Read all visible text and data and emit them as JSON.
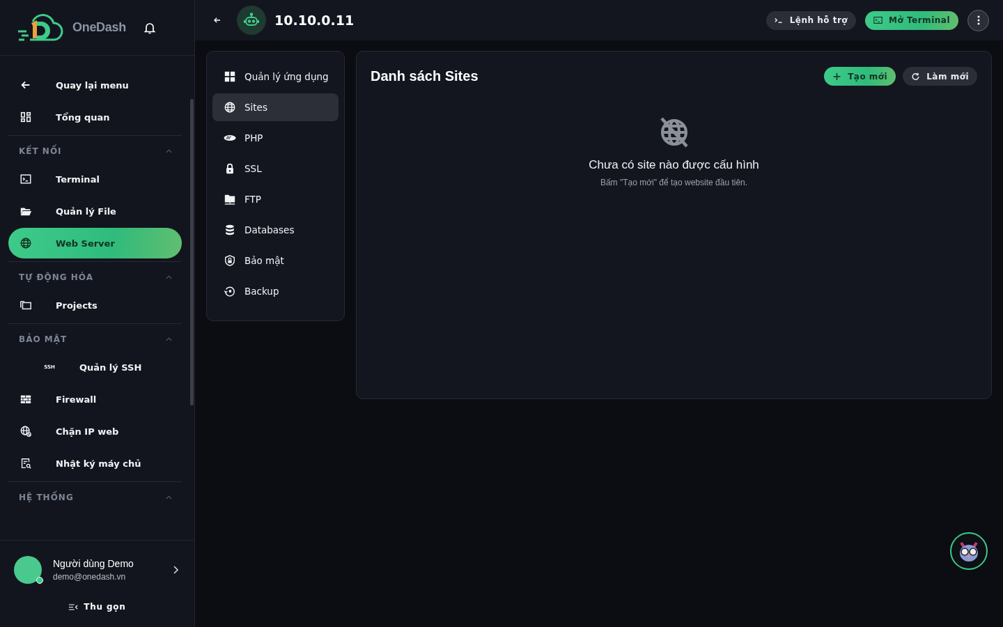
{
  "brand": {
    "name": "OneDash"
  },
  "sidebar": {
    "top_items": [
      {
        "label": "Quay lại menu",
        "kind": "back",
        "selected": false
      },
      {
        "label": "Tổng quan",
        "kind": "dashboard",
        "selected": false
      }
    ],
    "sections": [
      {
        "heading": "KẾT NỐI",
        "expanded": true,
        "items": [
          {
            "label": "Terminal",
            "kind": "terminal",
            "selected": false
          },
          {
            "label": "Quản lý File",
            "kind": "folder",
            "selected": false
          },
          {
            "label": "Web Server",
            "kind": "globe",
            "selected": true
          }
        ]
      },
      {
        "heading": "TỰ ĐỘNG HÓA",
        "expanded": true,
        "items": [
          {
            "label": "Projects",
            "kind": "projects",
            "selected": false
          }
        ]
      },
      {
        "heading": "BẢO MẬT",
        "expanded": true,
        "items": [
          {
            "label": "Quản lý SSH",
            "kind": "ssh",
            "icon_text": "SSH",
            "selected": false
          },
          {
            "label": "Firewall",
            "kind": "wall",
            "selected": false
          },
          {
            "label": "Chặn IP web",
            "kind": "globeblock",
            "selected": false
          },
          {
            "label": "Nhật ký máy chủ",
            "kind": "log",
            "selected": false
          }
        ]
      },
      {
        "heading": "HỆ THỐNG",
        "expanded": true
      }
    ]
  },
  "user": {
    "name": "Người dùng Demo",
    "email": "demo@onedash.vn",
    "online": true
  },
  "collapse_label": "Thu gọn",
  "header": {
    "host": "10.10.0.11",
    "buttons": [
      {
        "label": "Lệnh hỗ trợ",
        "kind": "commands"
      },
      {
        "label": "Mở Terminal",
        "kind": "terminal"
      }
    ]
  },
  "app_menu": [
    {
      "label": "Quản lý ứng dụng",
      "kind": "apps",
      "selected": false
    },
    {
      "label": "Sites",
      "kind": "globe",
      "selected": true
    },
    {
      "label": "PHP",
      "kind": "php",
      "selected": false
    },
    {
      "label": "SSL",
      "kind": "lock",
      "selected": false
    },
    {
      "label": "FTP",
      "kind": "ftp",
      "selected": false
    },
    {
      "label": "Databases",
      "kind": "db",
      "selected": false
    },
    {
      "label": "Bảo mật",
      "kind": "shield",
      "selected": false
    },
    {
      "label": "Backup",
      "kind": "backup",
      "selected": false
    }
  ],
  "panel": {
    "title": "Danh sách Sites",
    "buttons": [
      {
        "label": "Tạo mới",
        "kind": "create"
      },
      {
        "label": "Làm mới",
        "kind": "refresh"
      }
    ],
    "empty_title": "Chưa có site nào được cấu hình",
    "empty_hint": "Bấm \"Tạo mới\" để tạo website đầu tiên."
  }
}
